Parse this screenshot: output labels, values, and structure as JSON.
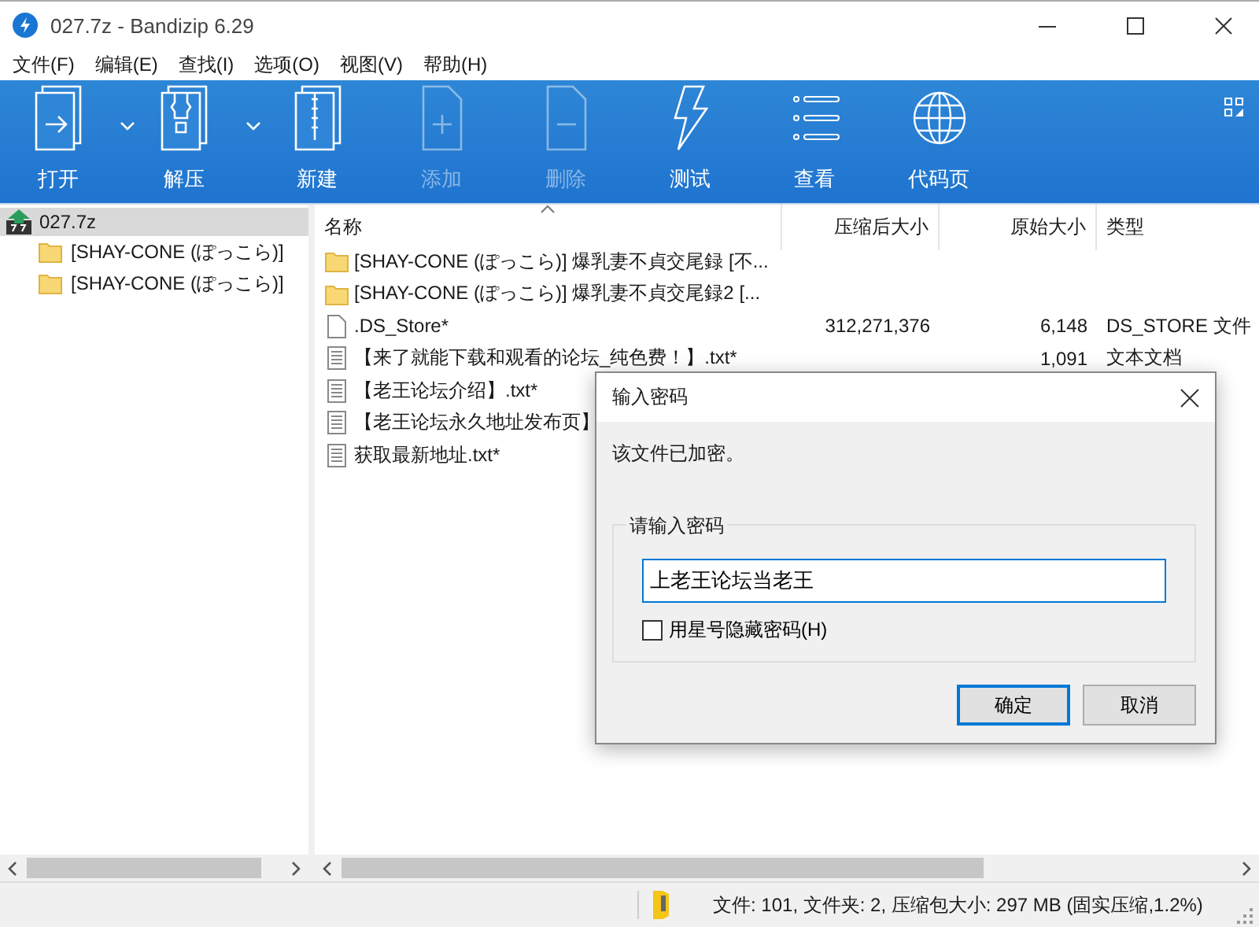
{
  "window": {
    "title": "027.7z - Bandizip 6.29"
  },
  "menu": [
    "文件(F)",
    "编辑(E)",
    "查找(I)",
    "选项(O)",
    "视图(V)",
    "帮助(H)"
  ],
  "toolbar": [
    {
      "label": "打开",
      "kind": "open",
      "dropdown": true,
      "disabled": false
    },
    {
      "label": "解压",
      "kind": "extract",
      "dropdown": true,
      "disabled": false
    },
    {
      "label": "新建",
      "kind": "new",
      "dropdown": false,
      "disabled": false
    },
    {
      "label": "添加",
      "kind": "add",
      "dropdown": false,
      "disabled": true
    },
    {
      "label": "删除",
      "kind": "delete",
      "dropdown": false,
      "disabled": true
    },
    {
      "label": "测试",
      "kind": "test",
      "dropdown": false,
      "disabled": false
    },
    {
      "label": "查看",
      "kind": "view",
      "dropdown": false,
      "disabled": false
    },
    {
      "label": "代码页",
      "kind": "codepage",
      "dropdown": false,
      "disabled": false
    }
  ],
  "tree": {
    "label": "027.7z",
    "selected": true,
    "children": [
      {
        "label": "[SHAY-CONE (ぽっこら)]",
        "selected": false
      },
      {
        "label": "[SHAY-CONE (ぽっこら)]",
        "selected": false
      }
    ]
  },
  "table": {
    "columns": [
      {
        "label": "名称",
        "sorted": true
      },
      {
        "label": "压缩后大小",
        "sorted": false
      },
      {
        "label": "原始大小",
        "sorted": false
      },
      {
        "label": "类型",
        "sorted": false
      }
    ],
    "rows": [
      {
        "kind": "folder",
        "name": "[SHAY-CONE (ぽっこら)] 爆乳妻不貞交尾録 [不...",
        "packed": "",
        "size": "",
        "type": ""
      },
      {
        "kind": "folder",
        "name": "[SHAY-CONE (ぽっこら)] 爆乳妻不貞交尾録2 [...",
        "packed": "",
        "size": "",
        "type": ""
      },
      {
        "kind": "file",
        "name": ".DS_Store*",
        "packed": "312,271,376",
        "size": "6,148",
        "type": "DS_STORE 文件"
      },
      {
        "kind": "text",
        "name": "【来了就能下载和观看的论坛_纯色费！】.txt*",
        "packed": "",
        "size": "1,091",
        "type": "文本文档"
      },
      {
        "kind": "text",
        "name": "【老王论坛介绍】.txt*"
      },
      {
        "kind": "text",
        "name": "【老王论坛永久地址发布页】"
      },
      {
        "kind": "text",
        "name": "获取最新地址.txt*"
      }
    ]
  },
  "status_bar": "文件: 101, 文件夹: 2, 压缩包大小: 297 MB (固实压缩,1.2%)",
  "dialog": {
    "title": "输入密码",
    "message": "该文件已加密。",
    "group_label": "请输入密码",
    "password": "上老王论坛当老王",
    "hide_checkbox": {
      "label": "用星号隐藏密码(H)",
      "checked": false
    },
    "buttons": [
      {
        "label": "确定",
        "default": true
      },
      {
        "label": "取消",
        "default": false
      }
    ]
  }
}
